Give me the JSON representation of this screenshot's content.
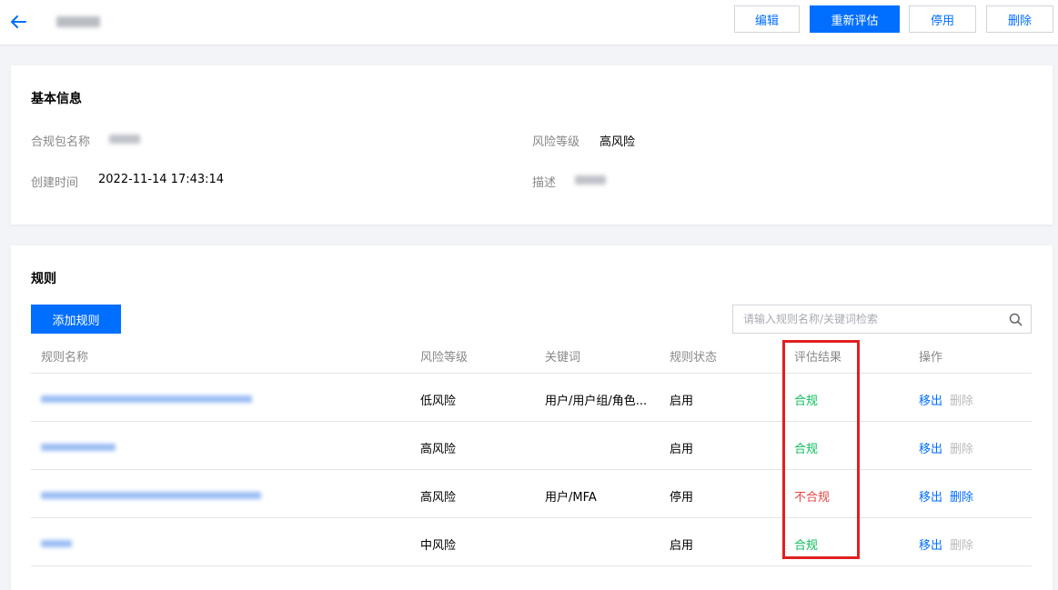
{
  "header": {
    "actions": {
      "edit": "编辑",
      "reevaluate": "重新评估",
      "disable": "停用",
      "delete": "删除"
    }
  },
  "basic_info": {
    "title": "基本信息",
    "package_name_label": "合规包名称",
    "risk_level_label": "风险等级",
    "risk_level_value": "高风险",
    "created_time_label": "创建时间",
    "created_time_value": "2022-11-14 17:43:14",
    "description_label": "描述"
  },
  "rules": {
    "title": "规则",
    "add_button": "添加规则",
    "search_placeholder": "请输入规则名称/关键词检索",
    "columns": {
      "name": "规则名称",
      "risk": "风险等级",
      "keywords": "关键词",
      "status": "规则状态",
      "result": "评估结果",
      "actions": "操作"
    },
    "rows": [
      {
        "risk": "低风险",
        "keywords": "用户/用户组/角色...",
        "status": "启用",
        "result": "合规",
        "remove": "移出",
        "delete": "删除"
      },
      {
        "risk": "高风险",
        "keywords": "",
        "status": "启用",
        "result": "合规",
        "remove": "移出",
        "delete": "删除"
      },
      {
        "risk": "高风险",
        "keywords": "用户/MFA",
        "status": "停用",
        "result": "不合规",
        "remove": "移出",
        "delete": "删除"
      },
      {
        "risk": "中风险",
        "keywords": "",
        "status": "启用",
        "result": "合规",
        "remove": "移出",
        "delete": "删除"
      }
    ]
  },
  "colors": {
    "primary": "#006eff",
    "compliant": "#0abf5b",
    "noncompliant": "#e54545",
    "highlight": "#e02020"
  }
}
